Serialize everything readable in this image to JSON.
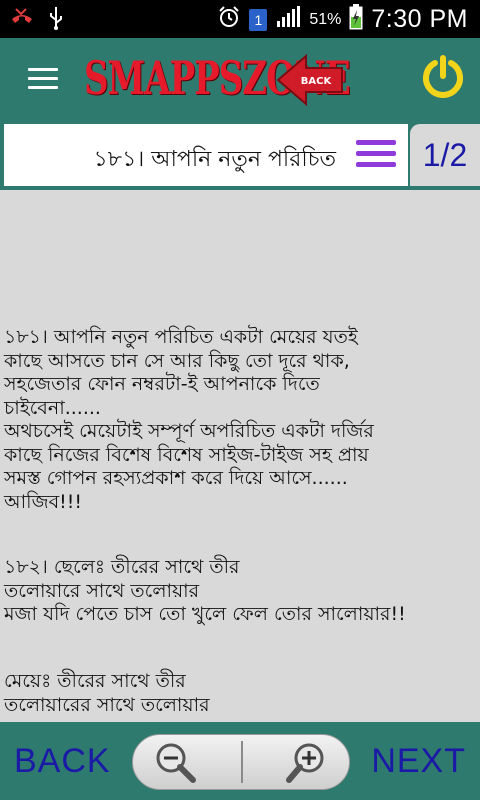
{
  "status_bar": {
    "battery_percent": "51%",
    "time": "7:30 PM",
    "sim": "1",
    "icons": [
      "missed-call-icon",
      "usb-icon",
      "alarm-icon",
      "sim-icon",
      "signal-icon",
      "battery-icon"
    ]
  },
  "header": {
    "logo_text": "SMAPPSZONE",
    "back_icon_label": "BACK",
    "accent_color": "#2e7a6e",
    "logo_color": "#e51b2b",
    "power_color": "#f2d51a"
  },
  "title_row": {
    "title": "১৮১। আপনি নতুন পরিচিত",
    "page_indicator": "1/2"
  },
  "content": {
    "paragraphs": [
      "১৮১। আপনি নতুন পরিচিত একটা মেয়ের যতই\nকাছে আসতে চান সে আর কিছু তো দূরে থাক,\nসহজেতার ফোন নম্বরটা-ই আপনাকে দিতে\nচাইবেনা......\nঅথচসেই মেয়েটাই সম্পূর্ণ অপরিচিত একটা দর্জির\nকাছে নিজের বিশেষ বিশেষ সাইজ-টাইজ সহ প্রায়\nসমস্ত গোপন রহস্যপ্রকাশ করে দিয়ে আসে......\nআজিব!!!",
      "১৮২। ছেলেঃ তীরের সাথে তীর\nতলোয়ারে সাথে তলোয়ার\nমজা যদি পেতে চাস তো খুলে ফেল তোর সালোয়ার!!",
      "মেয়েঃ তীরের সাথে তীর\nতলোয়ারের সাথে তলোয়ার"
    ]
  },
  "bottom_bar": {
    "back_label": "BACK",
    "next_label": "NEXT"
  }
}
